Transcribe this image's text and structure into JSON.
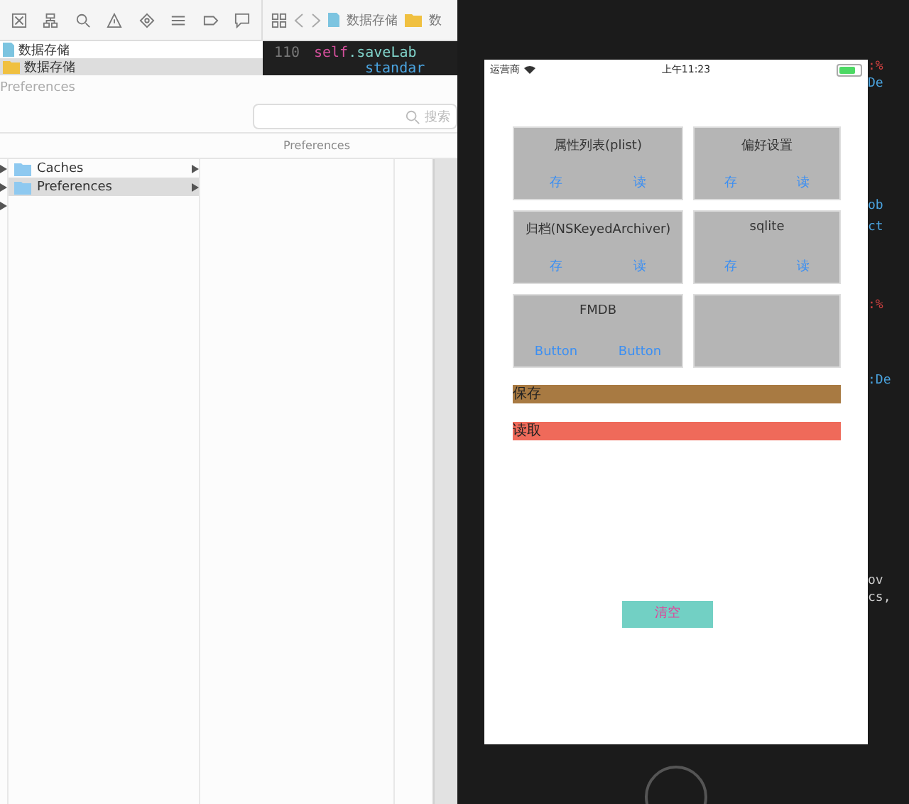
{
  "xcode": {
    "jump_bar": {
      "crumbs": [
        "数据存储",
        "数"
      ]
    },
    "navigator": {
      "items": [
        {
          "label": "数据存储",
          "kind": "file",
          "selected": false
        },
        {
          "label": "数据存储",
          "kind": "folder",
          "selected": true
        }
      ]
    },
    "code": {
      "line_number": "110",
      "lines": [
        {
          "kind": "keyword",
          "text": "self",
          "rest": ".saveLab"
        },
        {
          "kind": "plain",
          "text": "standar"
        }
      ]
    },
    "right_fragments": [
      ":%",
      "De",
      "ob",
      "ct",
      ":%",
      ":De",
      "ov",
      "cs,"
    ]
  },
  "finder_dialog": {
    "title": "Preferences",
    "search": {
      "placeholder": "搜索"
    },
    "column_header": "Preferences",
    "items": [
      {
        "label": "Caches",
        "selected": false
      },
      {
        "label": "Preferences",
        "selected": true
      }
    ]
  },
  "phone": {
    "status_bar": {
      "carrier": "运营商",
      "time": "上午11:23"
    },
    "cards": [
      {
        "kind": "demo",
        "title": "属性列表(plist)",
        "buttons": [
          "存",
          "读"
        ]
      },
      {
        "kind": "demo",
        "title": "偏好设置",
        "buttons": [
          "存",
          "读"
        ]
      },
      {
        "kind": "demo",
        "title": "归档(NSKeyedArchiver)",
        "buttons": [
          "存",
          "读"
        ]
      },
      {
        "kind": "demo",
        "title": "sqlite",
        "buttons": [
          "存",
          "读"
        ]
      },
      {
        "kind": "demo",
        "title": "FMDB",
        "buttons": [
          "Button",
          "Button"
        ]
      },
      {
        "kind": "empty"
      }
    ],
    "bars": [
      {
        "label": "保存",
        "color": "#a87a42"
      },
      {
        "label": "读取",
        "color": "#ef6a5a"
      }
    ],
    "clear_button": "清空"
  }
}
